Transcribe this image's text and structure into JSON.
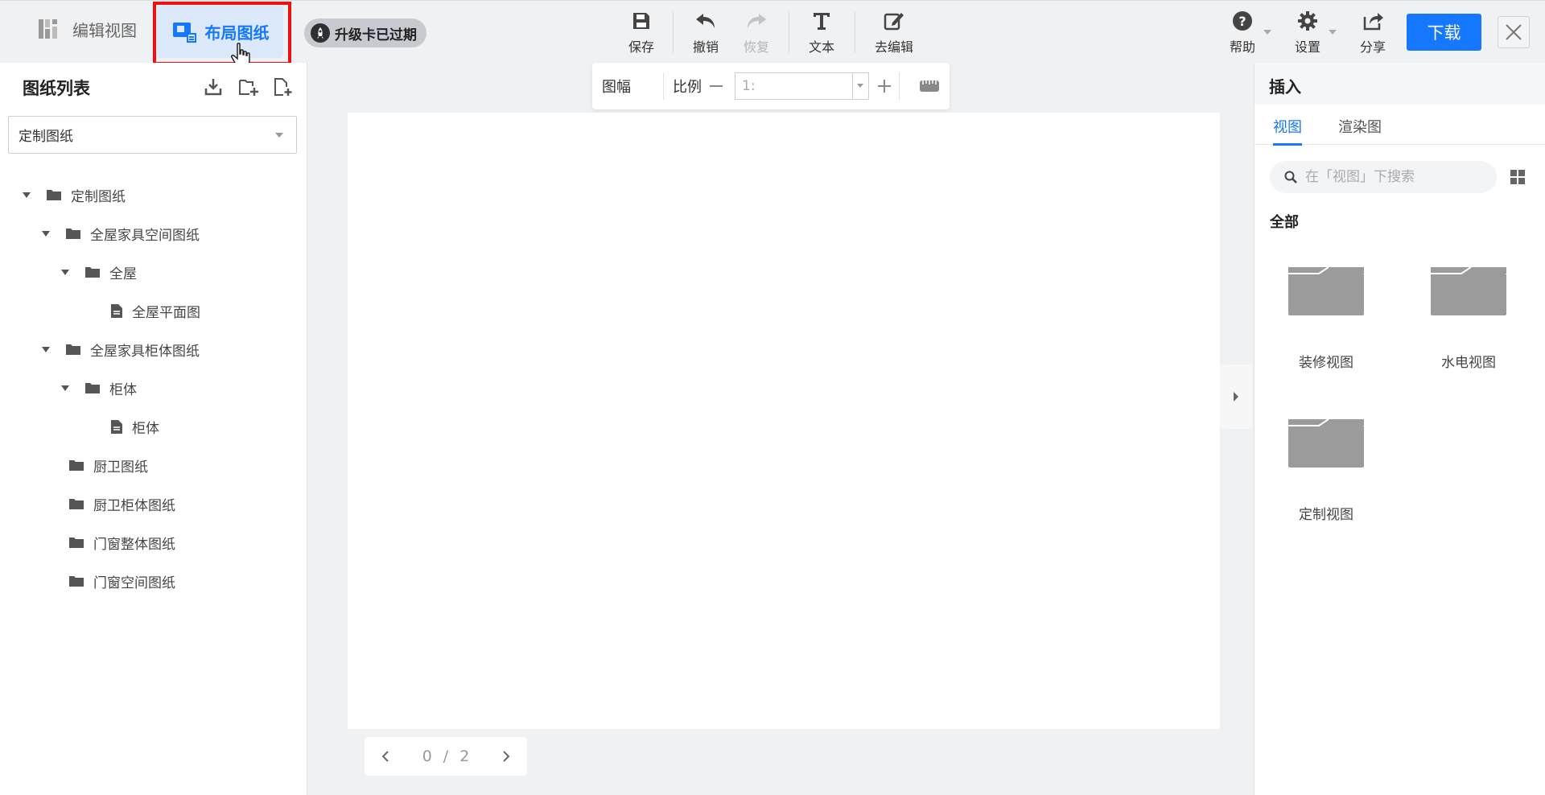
{
  "header": {
    "edit_view_label": "编辑视图",
    "layout_label": "布局图纸",
    "upgrade_label": "升级卡已过期",
    "tools": {
      "save": "保存",
      "undo": "撤销",
      "redo": "恢复",
      "text": "文本",
      "go_edit": "去编辑"
    },
    "right_tools": {
      "help": "帮助",
      "settings": "设置",
      "share": "分享"
    },
    "download_label": "下载"
  },
  "left_panel": {
    "title": "图纸列表",
    "select_value": "定制图纸",
    "tree": [
      {
        "label": "定制图纸",
        "type": "folder",
        "expanded": true
      },
      {
        "label": "全屋家具空间图纸",
        "type": "folder",
        "expanded": true
      },
      {
        "label": "全屋",
        "type": "folder",
        "expanded": true
      },
      {
        "label": "全屋平面图",
        "type": "file"
      },
      {
        "label": "全屋家具柜体图纸",
        "type": "folder",
        "expanded": true
      },
      {
        "label": "柜体",
        "type": "folder",
        "expanded": true
      },
      {
        "label": "柜体",
        "type": "file"
      },
      {
        "label": "厨卫图纸",
        "type": "folder"
      },
      {
        "label": "厨卫柜体图纸",
        "type": "folder"
      },
      {
        "label": "门窗整体图纸",
        "type": "folder"
      },
      {
        "label": "门窗空间图纸",
        "type": "folder"
      }
    ]
  },
  "canvas": {
    "paper_size_label": "图幅",
    "scale_label": "比例",
    "scale_value": "1:",
    "pager": {
      "current": "0",
      "separator": "/",
      "total": "2"
    }
  },
  "right_panel": {
    "title": "插入",
    "tabs": [
      "视图",
      "渲染图"
    ],
    "active_tab": "视图",
    "search_placeholder": "在「视图」下搜索",
    "section_label": "全部",
    "views": [
      "装修视图",
      "水电视图",
      "定制视图"
    ]
  },
  "colors": {
    "accent": "#1677ff",
    "highlight": "#ee1111",
    "folder_gray": "#9b9b9b"
  }
}
